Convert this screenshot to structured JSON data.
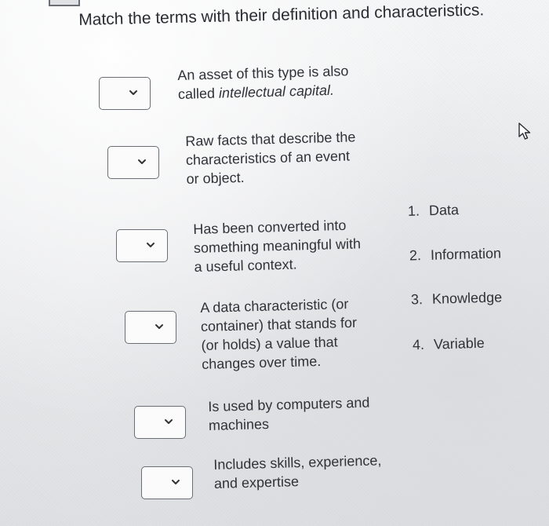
{
  "title": "Match the terms with their definition and characteristics.",
  "prompts": [
    {
      "line1": "An asset of this type is also",
      "line2_a": "called ",
      "line2_em": "intellectual capital.",
      "line3": "",
      "line4": ""
    },
    {
      "line1": "Raw facts that describe the",
      "line2_a": "characteristics of an event",
      "line2_em": "",
      "line3": "or object.",
      "line4": ""
    },
    {
      "line1": "Has been converted into",
      "line2_a": "something meaningful with",
      "line2_em": "",
      "line3": "a useful context.",
      "line4": ""
    },
    {
      "line1": "A data characteristic (or",
      "line2_a": "container) that stands for",
      "line2_em": "",
      "line3": "(or holds) a value that",
      "line4": "changes over time."
    },
    {
      "line1": "Is used by computers and",
      "line2_a": "machines",
      "line2_em": "",
      "line3": "",
      "line4": ""
    },
    {
      "line1": "Includes skills, experience,",
      "line2_a": "and expertise",
      "line2_em": "",
      "line3": "",
      "line4": ""
    }
  ],
  "options": [
    {
      "number": "1.",
      "label": "Data"
    },
    {
      "number": "2.",
      "label": "Information"
    },
    {
      "number": "3.",
      "label": "Knowledge"
    },
    {
      "number": "4.",
      "label": "Variable"
    }
  ]
}
